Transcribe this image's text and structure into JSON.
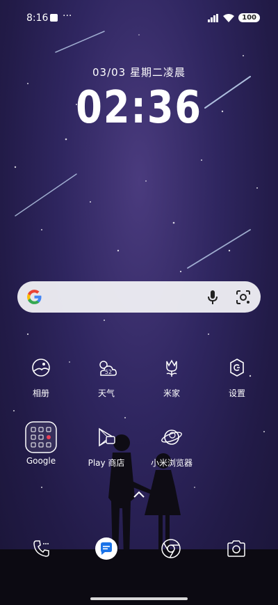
{
  "status_bar": {
    "time": "8:16",
    "overflow": "···",
    "battery": "100",
    "icons": [
      "signal-icon",
      "wifi-icon",
      "battery-icon"
    ]
  },
  "lockscreen": {
    "date": "03/03  星期二凌晨",
    "clock": "02:36"
  },
  "search_bar": {
    "icons": [
      "google-g-icon",
      "microphone-icon",
      "google-lens-icon"
    ]
  },
  "apps_row1": [
    {
      "label": "相册",
      "icon": "gallery-icon"
    },
    {
      "label": "天气",
      "icon": "weather-icon",
      "badge": "52"
    },
    {
      "label": "米家",
      "icon": "mijia-tulip-icon"
    },
    {
      "label": "设置",
      "icon": "settings-icon"
    }
  ],
  "apps_row2": [
    {
      "label": "Google",
      "icon": "google-folder-icon"
    },
    {
      "label": "Play 商店",
      "icon": "play-store-icon"
    },
    {
      "label": "小米浏览器",
      "icon": "browser-planet-icon"
    }
  ],
  "dock": {
    "icons": [
      "phone-icon",
      "messages-icon",
      "chrome-icon",
      "camera-icon"
    ]
  },
  "colors": {
    "sky_top": "#4a3b7e",
    "sky_bottom": "#1a1537",
    "ground": "#0c0a12",
    "search_bg": "#f0f0f4"
  }
}
